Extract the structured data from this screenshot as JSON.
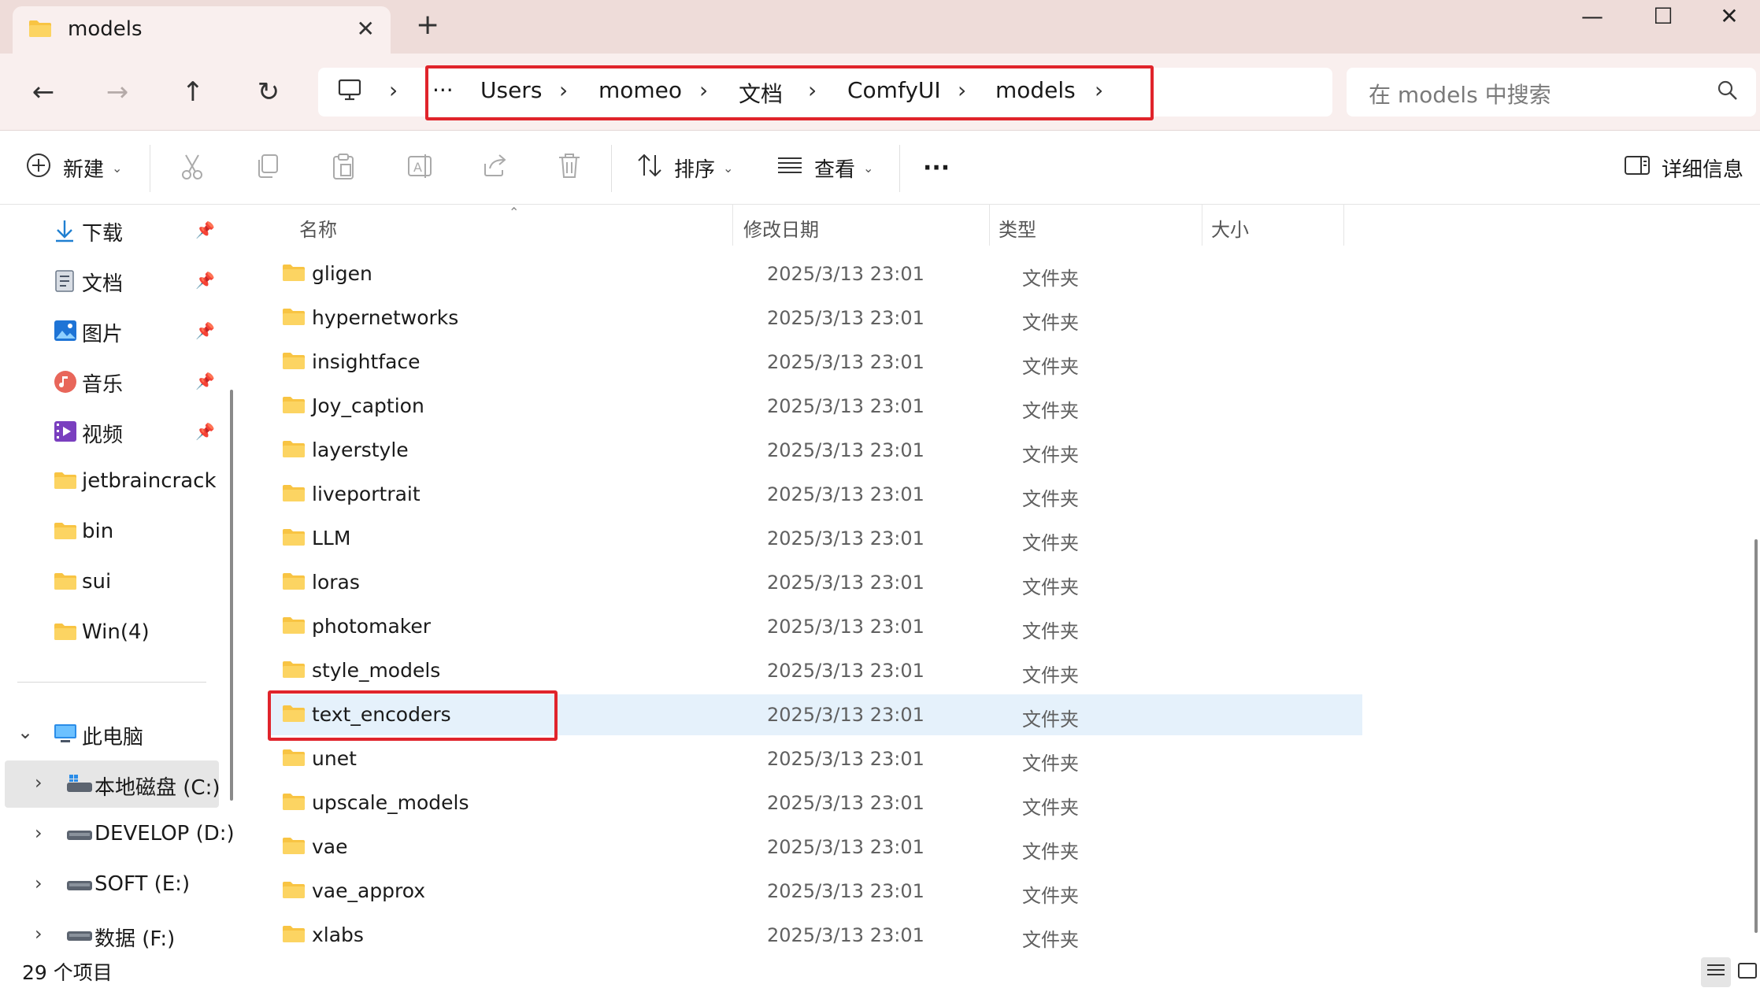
{
  "window": {
    "tab_title": "models",
    "new_tab": "+",
    "close_tab": "✕",
    "minimize": "—",
    "maximize": "☐",
    "close": "✕"
  },
  "nav": {
    "back": "←",
    "forward": "→",
    "up": "↑",
    "refresh": "↻",
    "more_crumbs": "···",
    "separator": "›",
    "breadcrumbs": [
      "Users",
      "momeo",
      "文档",
      "ComfyUI",
      "models"
    ],
    "search_placeholder": "在 models 中搜索"
  },
  "toolbar": {
    "new_label": "新建",
    "sort_label": "排序",
    "view_label": "查看",
    "more": "···",
    "details_label": "详细信息"
  },
  "sidebar": {
    "quick_access": [
      {
        "label": "下载",
        "icon": "download-icon",
        "pinned": true
      },
      {
        "label": "文档",
        "icon": "documents-icon",
        "pinned": true
      },
      {
        "label": "图片",
        "icon": "pictures-icon",
        "pinned": true
      },
      {
        "label": "音乐",
        "icon": "music-icon",
        "pinned": true
      },
      {
        "label": "视频",
        "icon": "videos-icon",
        "pinned": true
      },
      {
        "label": "jetbraincrack",
        "icon": "folder-icon",
        "pinned": false
      },
      {
        "label": "bin",
        "icon": "folder-icon",
        "pinned": false
      },
      {
        "label": "sui",
        "icon": "folder-icon",
        "pinned": false
      },
      {
        "label": "Win(4)",
        "icon": "folder-icon",
        "pinned": false
      }
    ],
    "this_pc": "此电脑",
    "drives": [
      {
        "label": "本地磁盘 (C:)",
        "selected": true
      },
      {
        "label": "DEVELOP (D:)",
        "selected": false
      },
      {
        "label": "SOFT (E:)",
        "selected": false
      },
      {
        "label": "数据 (F:)",
        "selected": false
      }
    ]
  },
  "columns": {
    "name": "名称",
    "modified": "修改日期",
    "type": "类型",
    "size": "大小"
  },
  "files": [
    {
      "name": "gligen",
      "date": "2025/3/13 23:01",
      "type": "文件夹"
    },
    {
      "name": "hypernetworks",
      "date": "2025/3/13 23:01",
      "type": "文件夹"
    },
    {
      "name": "insightface",
      "date": "2025/3/13 23:01",
      "type": "文件夹"
    },
    {
      "name": "Joy_caption",
      "date": "2025/3/13 23:01",
      "type": "文件夹"
    },
    {
      "name": "layerstyle",
      "date": "2025/3/13 23:01",
      "type": "文件夹"
    },
    {
      "name": "liveportrait",
      "date": "2025/3/13 23:01",
      "type": "文件夹"
    },
    {
      "name": "LLM",
      "date": "2025/3/13 23:01",
      "type": "文件夹"
    },
    {
      "name": "loras",
      "date": "2025/3/13 23:01",
      "type": "文件夹"
    },
    {
      "name": "photomaker",
      "date": "2025/3/13 23:01",
      "type": "文件夹"
    },
    {
      "name": "style_models",
      "date": "2025/3/13 23:01",
      "type": "文件夹"
    },
    {
      "name": "text_encoders",
      "date": "2025/3/13 23:01",
      "type": "文件夹",
      "selected": true
    },
    {
      "name": "unet",
      "date": "2025/3/13 23:01",
      "type": "文件夹"
    },
    {
      "name": "upscale_models",
      "date": "2025/3/13 23:01",
      "type": "文件夹"
    },
    {
      "name": "vae",
      "date": "2025/3/13 23:01",
      "type": "文件夹"
    },
    {
      "name": "vae_approx",
      "date": "2025/3/13 23:01",
      "type": "文件夹"
    },
    {
      "name": "xlabs",
      "date": "2025/3/13 23:01",
      "type": "文件夹"
    }
  ],
  "status": {
    "item_count": "29 个项目"
  },
  "colors": {
    "titlebar": "#eedcd9",
    "navbar": "#f9efee",
    "highlight_red": "#e0242b",
    "selection": "#e5f1fb",
    "folder": "#f8c443"
  }
}
